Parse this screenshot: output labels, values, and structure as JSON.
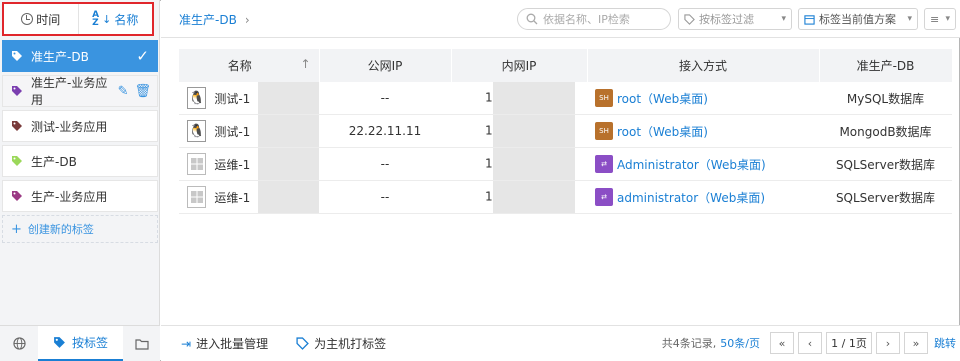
{
  "sidebar": {
    "sort": {
      "time_label": "时间",
      "name_label": "名称"
    },
    "tags": [
      {
        "label": "准生产-DB",
        "color": "#ffffff",
        "active": true
      },
      {
        "label": "准生产-业务应用",
        "color": "#7b3fb0",
        "hovered": true
      },
      {
        "label": "测试-业务应用",
        "color": "#7a3b3b"
      },
      {
        "label": "生产-DB",
        "color": "#9bd85a"
      },
      {
        "label": "生产-业务应用",
        "color": "#9b3a84"
      }
    ],
    "new_tag_label": "创建新的标签",
    "footer": {
      "tags_label": "按标签"
    }
  },
  "topbar": {
    "breadcrumb": "准生产-DB",
    "search_placeholder": "依据名称、IP检索",
    "filter_label": "按标签过滤",
    "scheme_label": "标签当前值方案"
  },
  "table": {
    "headers": [
      "名称",
      "公网IP",
      "内网IP",
      "接入方式",
      "准生产-DB"
    ],
    "sort_indicator": "↑",
    "rows": [
      {
        "os": "linux",
        "name": "测试-1",
        "public_ip": "--",
        "private_ip": "1",
        "protocol": "ssh",
        "access": "root（Web桌面)",
        "db": "MySQL数据库"
      },
      {
        "os": "linux",
        "name": "测试-1",
        "public_ip": "22.22.11.11",
        "private_ip": "1",
        "protocol": "ssh",
        "access": "root（Web桌面)",
        "db": "MongodB数据库"
      },
      {
        "os": "windows",
        "name": "运维-1",
        "public_ip": "--",
        "private_ip": "1",
        "protocol": "rdp",
        "access": "Administrator（Web桌面)",
        "db": "SQLServer数据库"
      },
      {
        "os": "windows",
        "name": "运维-1",
        "public_ip": "--",
        "private_ip": "1",
        "protocol": "rdp",
        "access": "administrator（Web桌面)",
        "db": "SQLServer数据库"
      }
    ]
  },
  "bottombar": {
    "batch_label": "进入批量管理",
    "tag_host_label": "为主机打标签",
    "total_text": "共4条记录,",
    "page_size": "50条/页",
    "page_text": "1 / 1页",
    "jump_label": "跳转"
  },
  "colors": {
    "accent": "#1a7fd4",
    "active_tag": "#3a94e0",
    "highlight_border": "#e0262b"
  }
}
